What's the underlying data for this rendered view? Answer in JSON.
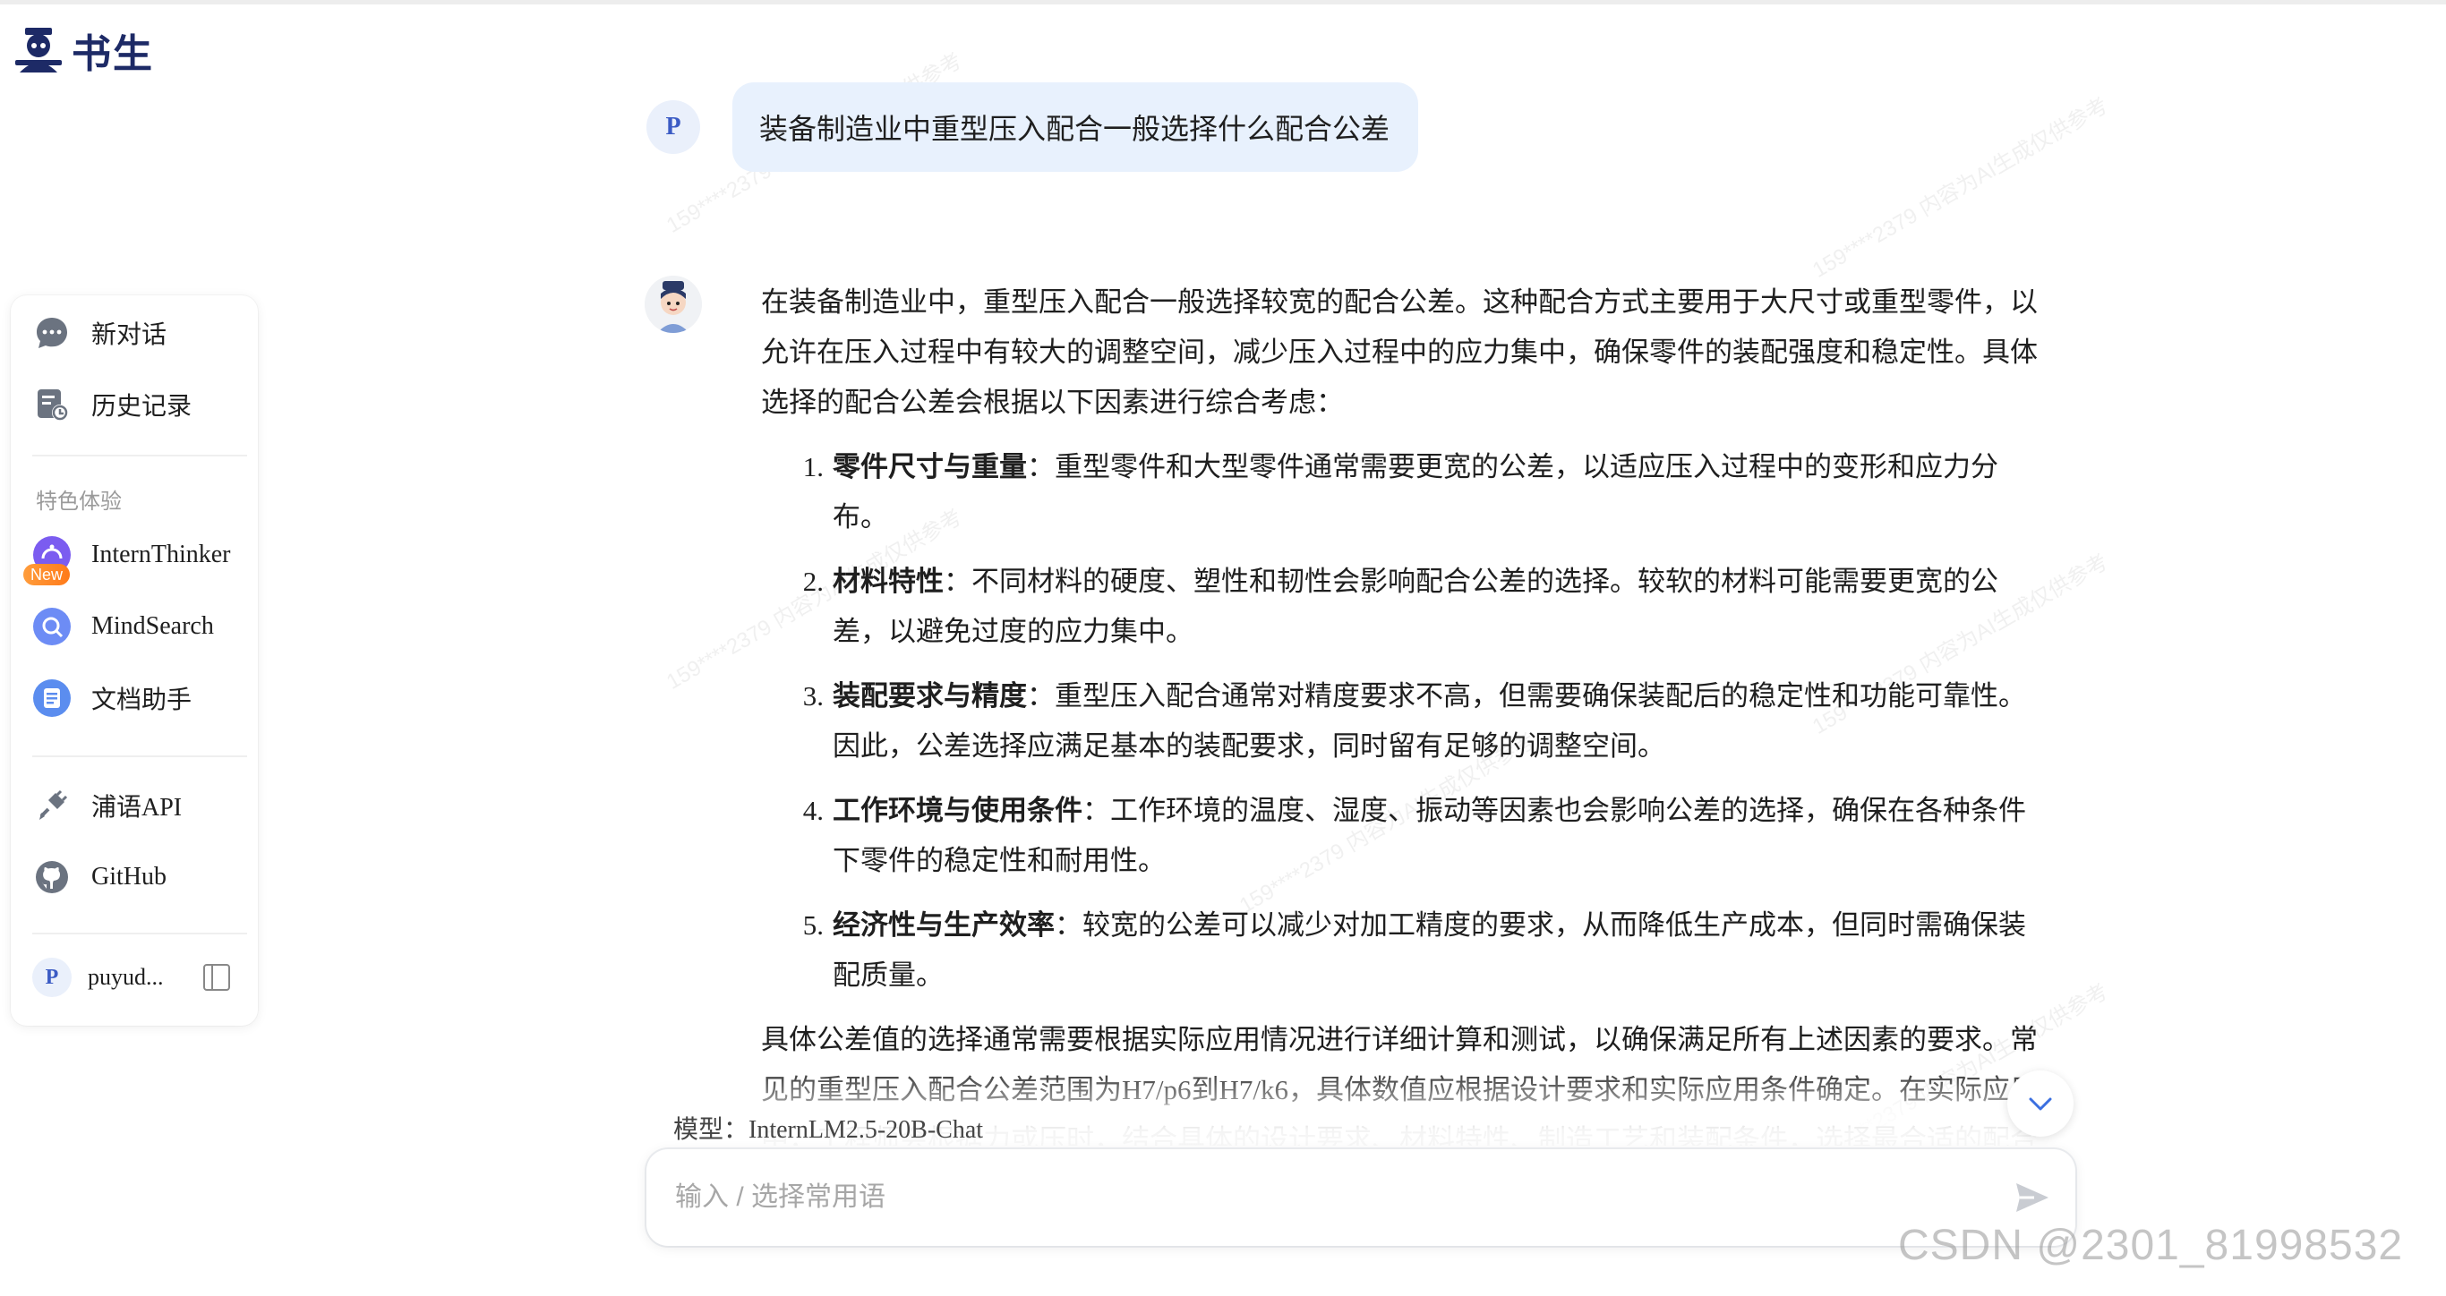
{
  "brand": {
    "name": "书生"
  },
  "sidebar": {
    "items": [
      {
        "label": "新对话",
        "icon": "chat-bubble-icon"
      },
      {
        "label": "历史记录",
        "icon": "history-icon"
      }
    ],
    "section_title": "特色体验",
    "features": [
      {
        "label": "InternThinker",
        "icon": "internthinker-icon",
        "badge": "New"
      },
      {
        "label": "MindSearch",
        "icon": "mindsearch-icon"
      },
      {
        "label": "文档助手",
        "icon": "document-assistant-icon"
      }
    ],
    "links": [
      {
        "label": "浦语API",
        "icon": "plug-icon"
      },
      {
        "label": "GitHub",
        "icon": "github-icon"
      }
    ],
    "user": {
      "avatar_letter": "P",
      "name": "puyud..."
    }
  },
  "chat": {
    "user_avatar_letter": "P",
    "user_message": "装备制造业中重型压入配合一般选择什么配合公差",
    "answer": {
      "intro": "在装备制造业中，重型压入配合一般选择较宽的配合公差。这种配合方式主要用于大尺寸或重型零件，以允许在压入过程中有较大的调整空间，减少压入过程中的应力集中，确保零件的装配强度和稳定性。具体选择的配合公差会根据以下因素进行综合考虑：",
      "items": [
        {
          "num": "1.",
          "title": "零件尺寸与重量",
          "text": "：重型零件和大型零件通常需要更宽的公差，以适应压入过程中的变形和应力分布。"
        },
        {
          "num": "2.",
          "title": "材料特性",
          "text": "：不同材料的硬度、塑性和韧性会影响配合公差的选择。较软的材料可能需要更宽的公差，以避免过度的应力集中。"
        },
        {
          "num": "3.",
          "title": "装配要求与精度",
          "text": "：重型压入配合通常对精度要求不高，但需要确保装配后的稳定性和功能可靠性。因此，公差选择应满足基本的装配要求，同时留有足够的调整空间。"
        },
        {
          "num": "4.",
          "title": "工作环境与使用条件",
          "text": "：工作环境的温度、湿度、振动等因素也会影响公差的选择，确保在各种条件下零件的稳定性和耐用性。"
        },
        {
          "num": "5.",
          "title": "经济性与生产效率",
          "text": "：较宽的公差可以减少对加工精度的要求，从而降低生产成本，但同时需确保装配质量。"
        }
      ],
      "outro": "具体公差值的选择通常需要根据实际应用情况进行详细计算和测试，以确保满足所有上述因素的要求。常见的重型压入配合公差范围为H7/p6到H7/k6，具体数值应根据设计要求和实际应用条件确定。在实际应用中，工程师会根据力或压时，结合具体的设计要求、材料特性、制造工艺和装配条件，选择最合适的配合公差。"
    }
  },
  "composer": {
    "model_label": "模型：InternLM2.5-20B-Chat",
    "placeholder": "输入 / 选择常用语"
  },
  "watermark": {
    "csdn": "CSDN @2301_81998532",
    "tile": "159****2379 内容为AI生成仅供参考"
  }
}
